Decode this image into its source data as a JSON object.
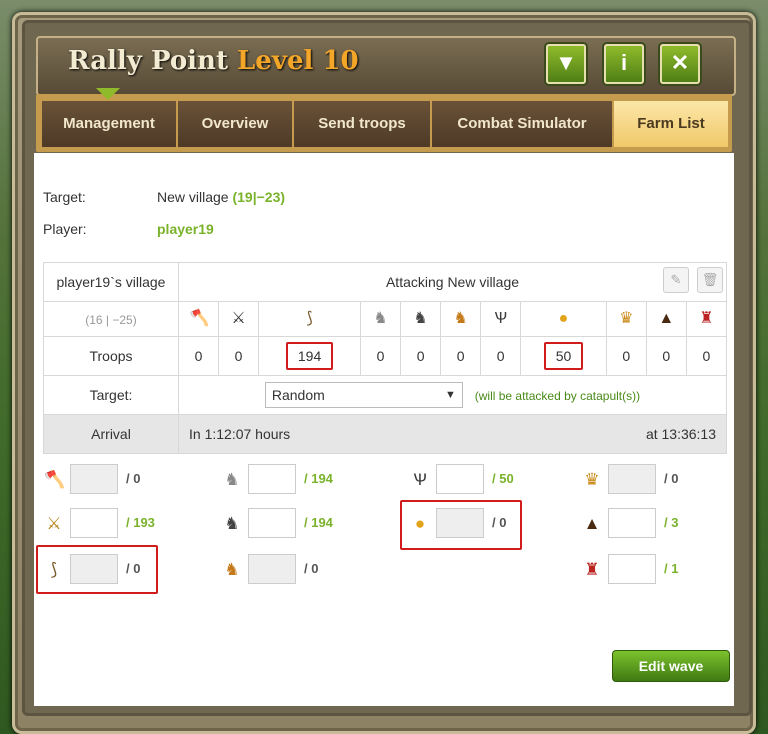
{
  "window": {
    "title": "Rally Point",
    "level_label": "Level 10",
    "buttons": {
      "collapse": "▼",
      "info": "i",
      "close": "✕"
    }
  },
  "tabs": [
    {
      "label": "Management"
    },
    {
      "label": "Overview"
    },
    {
      "label": "Send troops"
    },
    {
      "label": "Combat Simulator"
    },
    {
      "label": "Farm List",
      "active": true
    }
  ],
  "target": {
    "label": "Target:",
    "village": "New village",
    "coords": "(19|−23)"
  },
  "player": {
    "label": "Player:",
    "name": "player19"
  },
  "table": {
    "village_name": "player19`s village",
    "heading": "Attacking New village",
    "coords": "(16 | −25)",
    "unit_icons": [
      "clubswinger-icon",
      "spearman-icon",
      "axeman-icon",
      "scout-icon",
      "paladin-icon",
      "teutonic-knight-icon",
      "ram-icon",
      "catapult-icon",
      "chief-icon",
      "settler-icon",
      "hero-icon"
    ],
    "troops_label": "Troops",
    "troops": [
      "0",
      "0",
      "194",
      "0",
      "0",
      "0",
      "0",
      "50",
      "0",
      "0",
      "0"
    ],
    "target_label": "Target:",
    "target_select": "Random",
    "target_note": "(will be attacked by catapult(s))",
    "arrival_label": "Arrival",
    "arrival_in": "In 1:12:07 hours",
    "arrival_at": "at 13:36:13"
  },
  "wave": [
    {
      "icon": "clubswinger-icon",
      "max": "/ 0"
    },
    {
      "icon": "spearman-icon",
      "max": "/ 193"
    },
    {
      "icon": "axeman-icon",
      "max": "/ 0"
    },
    {
      "icon": "scout-icon",
      "max": "/ 194"
    },
    {
      "icon": "paladin-icon",
      "max": "/ 194"
    },
    {
      "icon": "teutonic-knight-icon",
      "max": "/ 0"
    },
    {
      "icon": "ram-icon",
      "max": "/ 50"
    },
    {
      "icon": "catapult-icon",
      "max": "/ 0"
    },
    {
      "icon": "chief-icon",
      "max": "/ 0"
    },
    {
      "icon": "settler-icon",
      "max": "/ 3"
    },
    {
      "icon": "hero-icon",
      "max": "/ 1"
    }
  ],
  "edit_wave_label": "Edit wave",
  "colors": {
    "accent_green": "#7ab32b",
    "highlight_red": "#d11c1c",
    "tab_active": "#f0c869",
    "level_orange": "#f4a628"
  }
}
